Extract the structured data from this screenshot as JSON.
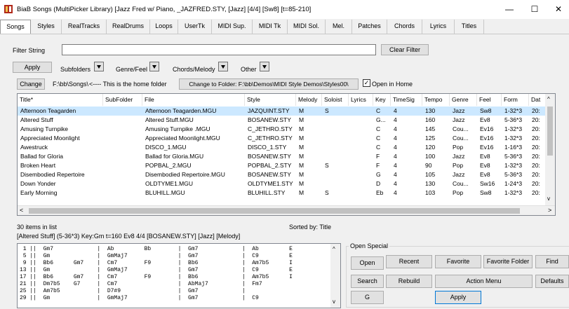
{
  "window": {
    "title": "BiaB Songs  (MultiPicker Library)  [Jazz Fred w/ Piano, _JAZFRED.STY,  [Jazz] [4/4] [Sw8] [t=85-210]",
    "minimize": "—",
    "maximize": "☐",
    "close": "✕"
  },
  "tabs": [
    "Songs",
    "Styles",
    "RealTracks",
    "RealDrums",
    "Loops",
    "UserTk",
    "MIDI Sup.",
    "MIDI Tk",
    "MIDI Sol.",
    "Mel.",
    "Patches",
    "Chords",
    "Lyrics",
    "Titles"
  ],
  "filter": {
    "label": "Filter String",
    "value": "",
    "clear_label": "Clear Filter",
    "apply_label": "Apply",
    "subfolders_label": "Subfolders",
    "genre_label": "Genre/Feel",
    "chords_label": "Chords/Melody",
    "other_label": "Other"
  },
  "folder": {
    "change_label": "Change",
    "path": "F:\\bb\\Songs\\",
    "home_note": "<---- This is the home folder",
    "change_to_label": "Change to Folder: F:\\bb\\Demos\\MIDI Style Demos\\Styles00\\",
    "open_in_home_label": "Open in Home",
    "open_in_home_checked": "✓"
  },
  "table": {
    "columns": [
      "Title*",
      "SubFolder",
      "File",
      "Style",
      "Melody",
      "Soloist",
      "Lyrics",
      "Key",
      "TimeSig",
      "Tempo",
      "Genre",
      "Feel",
      "Form",
      "Dat"
    ],
    "rows": [
      [
        "Afternoon Teagarden",
        "",
        "Afternoon Teagarden.MGU",
        "JAZQUINT.STY",
        "M",
        "S",
        "",
        "C",
        "4",
        "130",
        "Jazz",
        "Sw8",
        "1-32*3",
        "20:"
      ],
      [
        "Altered Stuff",
        "",
        "Altered Stuff.MGU",
        "BOSANEW.STY",
        "M",
        "",
        "",
        "G...",
        "4",
        "160",
        "Jazz",
        "Ev8",
        "5-36*3",
        "20:"
      ],
      [
        "Amusing Turnpike",
        "",
        "Amusing Turnpike .MGU",
        "C_JETHRO.STY",
        "M",
        "",
        "",
        "C",
        "4",
        "145",
        "Cou...",
        "Ev16",
        "1-32*3",
        "20:"
      ],
      [
        "Appreciated Moonlight",
        "",
        "Appreciated Moonlight.MGU",
        "C_JETHRO.STY",
        "M",
        "",
        "",
        "C",
        "4",
        "125",
        "Cou...",
        "Ev16",
        "1-32*3",
        "20:"
      ],
      [
        "Awestruck",
        "",
        "DISCO_1.MGU",
        "DISCO_1.STY",
        "M",
        "",
        "",
        "C",
        "4",
        "120",
        "Pop",
        "Ev16",
        "1-16*3",
        "20:"
      ],
      [
        "Ballad for Gloria",
        "",
        "Ballad for Gloria.MGU",
        "BOSANEW.STY",
        "M",
        "",
        "",
        "F",
        "4",
        "100",
        "Jazz",
        "Ev8",
        "5-36*3",
        "20:"
      ],
      [
        "Broken Heart",
        "",
        "POPBAL_2.MGU",
        "POPBAL_2.STY",
        "M",
        "S",
        "",
        "F",
        "4",
        "90",
        "Pop",
        "Ev8",
        "1-32*3",
        "20:"
      ],
      [
        "Disembodied Repertoire",
        "",
        "Disembodied Repertoire.MGU",
        "BOSANEW.STY",
        "M",
        "",
        "",
        "G",
        "4",
        "105",
        "Jazz",
        "Ev8",
        "5-36*3",
        "20:"
      ],
      [
        "Down Yonder",
        "",
        "OLDTYME1.MGU",
        "OLDTYME1.STY",
        "M",
        "",
        "",
        "D",
        "4",
        "130",
        "Cou...",
        "Sw16",
        "1-24*3",
        "20:"
      ],
      [
        "Early Morning",
        "",
        "BLUHILL.MGU",
        "BLUHILL.STY",
        "M",
        "S",
        "",
        "Eb",
        "4",
        "103",
        "Pop",
        "Sw8",
        "1-32*3",
        "20:"
      ]
    ]
  },
  "status": {
    "count": "30 items in list",
    "sorted_by": "Sorted by: Title",
    "selected_info": "[Altered Stuff]   (5-36*3) Key:Gm  t=160 Ev8  4/4  [BOSANEW.STY]  [Jazz]  [Melody]"
  },
  "chords": {
    "lines": [
      " 1 ||  Gm7             |  Ab         Bb        |  Gm7             |  Ab         E",
      " 5 ||  Gm              |  GmMaj7               |  Gm7             |  C9         E",
      " 9 ||  Bb6      Gm7    |  Cm7        F9        |  Bb6             |  Am7b5      I",
      "13 ||  Gm              |  GmMaj7               |  Gm7             |  C9         E",
      "17 ||  Bb6      Gm7    |  Cm7        F9        |  Bb6             |  Am7b5      I",
      "21 ||  Dm7b5    G7     |  Cm7                  |  AbMaj7          |  Fm7",
      "25 ||  Am7b5           |  D7#9                 |  Gm7             |",
      "29 ||  Gm              |  GmMaj7               |  Gm7             |  C9"
    ]
  },
  "open_special": {
    "label": "Open Special",
    "open": "Open",
    "recent": "Recent",
    "favorite": "Favorite",
    "favorite_folder": "Favorite Folder",
    "find": "Find",
    "search": "Search",
    "rebuild": "Rebuild",
    "action_menu": "Action Menu",
    "defaults": "Defaults",
    "g": "G",
    "apply": "Apply"
  }
}
